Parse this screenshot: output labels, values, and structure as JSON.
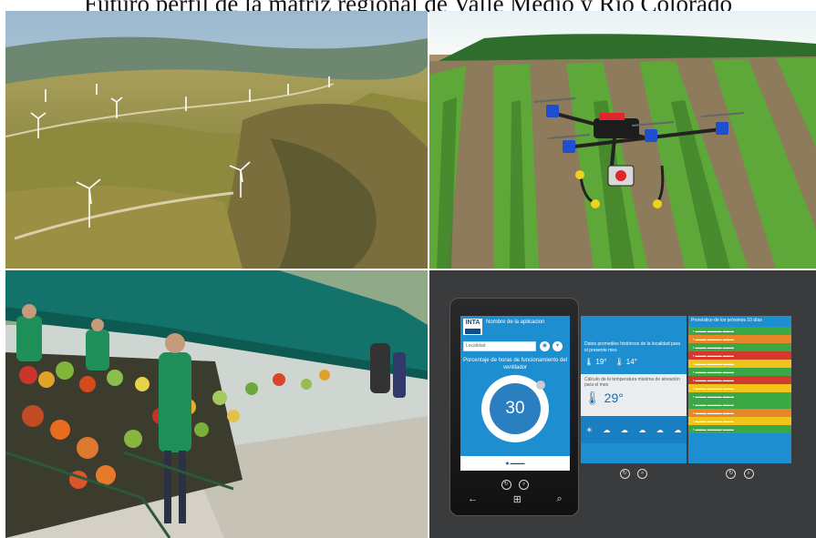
{
  "title": "Futuro perfil de la matriz regional de Valle Medio y Río Colorado",
  "app": {
    "logo": "INTA",
    "name": "Nombre de la aplicacion",
    "search_placeholder": "Localidad",
    "percent_label": "Porcentaje de horas de funcionamiento del ventilador",
    "percent_value": "30",
    "data_title": "Datos promedios históricos de la localidad para el presente mes",
    "temp_a": "19°",
    "temp_b": "14°",
    "calc_label": "Cálculo de la temperatura máxima de aireación para el mes",
    "calc_value": "29°",
    "forecast_title": "Pronóstico de los próximos 10 días",
    "colors": {
      "accent": "#1d8fd1",
      "row_green": "#3aa845",
      "row_yellow": "#f0c419",
      "row_red": "#d33a2c",
      "row_orange": "#e8862a"
    }
  },
  "forecast_rows": [
    {
      "color": "#3aa845"
    },
    {
      "color": "#e8862a"
    },
    {
      "color": "#3aa845"
    },
    {
      "color": "#d33a2c"
    },
    {
      "color": "#f0c419"
    },
    {
      "color": "#3aa845"
    },
    {
      "color": "#d33a2c"
    },
    {
      "color": "#f0c419"
    },
    {
      "color": "#3aa845"
    },
    {
      "color": "#3aa845"
    },
    {
      "color": "#e8862a"
    },
    {
      "color": "#f0c419"
    },
    {
      "color": "#3aa845"
    }
  ]
}
